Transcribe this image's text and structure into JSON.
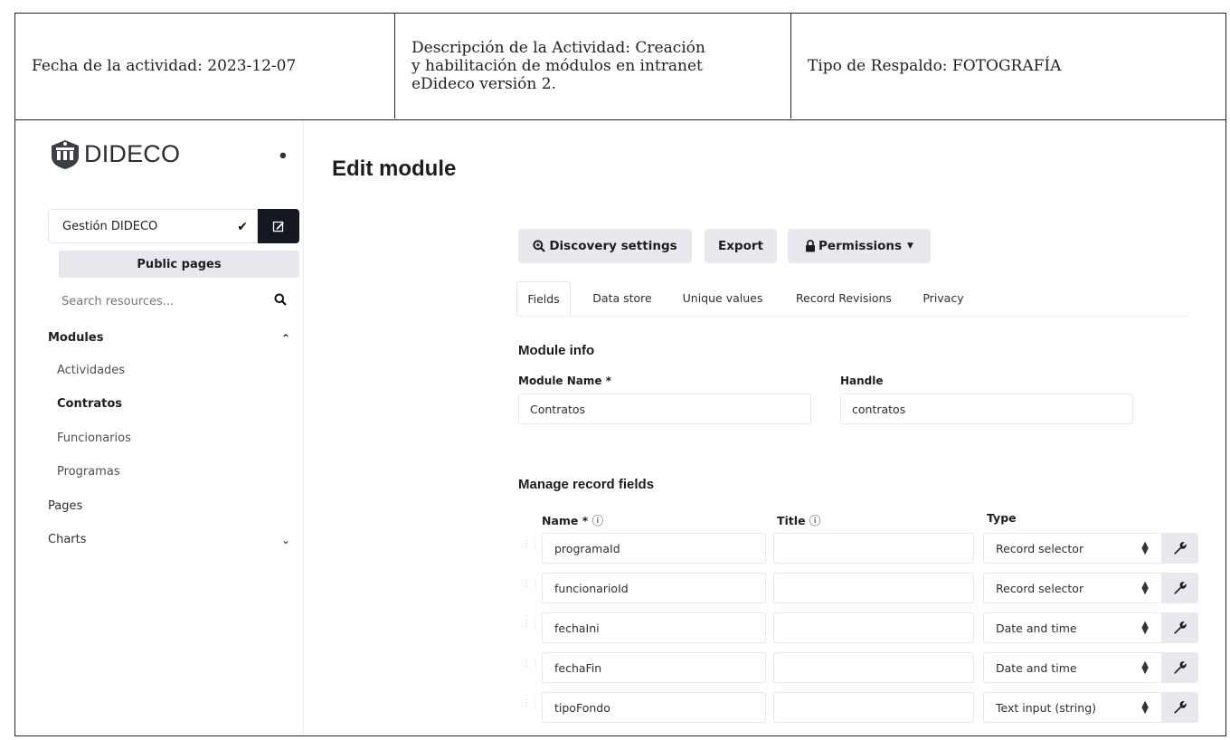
{
  "document_header": {
    "fecha": "Fecha de la actividad: 2023-12-07",
    "descripcion_1": "Descripción de la Actividad: Creación",
    "descripcion_2": "y habilitación de módulos en intranet",
    "descripcion_3": "eDideco versión 2.",
    "respaldo": "Tipo de Respaldo: FOTOGRAFÍA"
  },
  "sidebar": {
    "logo_text": "DIDECO",
    "namespace": "Gestión DIDECO",
    "public_pages_label": "Public pages",
    "search_placeholder": "Search resources...",
    "modules_label": "Modules",
    "modules": [
      {
        "label": "Actividades",
        "active": false
      },
      {
        "label": "Contratos",
        "active": true
      },
      {
        "label": "Funcionarios",
        "active": false
      },
      {
        "label": "Programas",
        "active": false
      }
    ],
    "pages_label": "Pages",
    "charts_label": "Charts"
  },
  "main": {
    "title": "Edit module",
    "toolbar": {
      "discovery_label": "Discovery settings",
      "export_label": "Export",
      "permissions_label": "Permissions"
    },
    "tabs": [
      {
        "label": "Fields",
        "active": true
      },
      {
        "label": "Data store",
        "active": false
      },
      {
        "label": "Unique values",
        "active": false
      },
      {
        "label": "Record Revisions",
        "active": false
      },
      {
        "label": "Privacy",
        "active": false
      }
    ],
    "module_info": {
      "heading": "Module info",
      "name_label": "Module Name *",
      "name_value": "Contratos",
      "handle_label": "Handle",
      "handle_value": "contratos"
    },
    "fields": {
      "heading": "Manage record fields",
      "col_name": "Name *",
      "col_title": "Title",
      "col_type": "Type",
      "rows": [
        {
          "name": "programaId",
          "title": "",
          "type": "Record selector"
        },
        {
          "name": "funcionarioId",
          "title": "",
          "type": "Record selector"
        },
        {
          "name": "fechaIni",
          "title": "",
          "type": "Date and time"
        },
        {
          "name": "fechaFin",
          "title": "",
          "type": "Date and time"
        },
        {
          "name": "tipoFondo",
          "title": "",
          "type": "Text input (string)"
        }
      ]
    }
  },
  "colors": {
    "dark_button": "#151820",
    "light_button": "#e7e9ee",
    "border": "#e6e8ec"
  }
}
